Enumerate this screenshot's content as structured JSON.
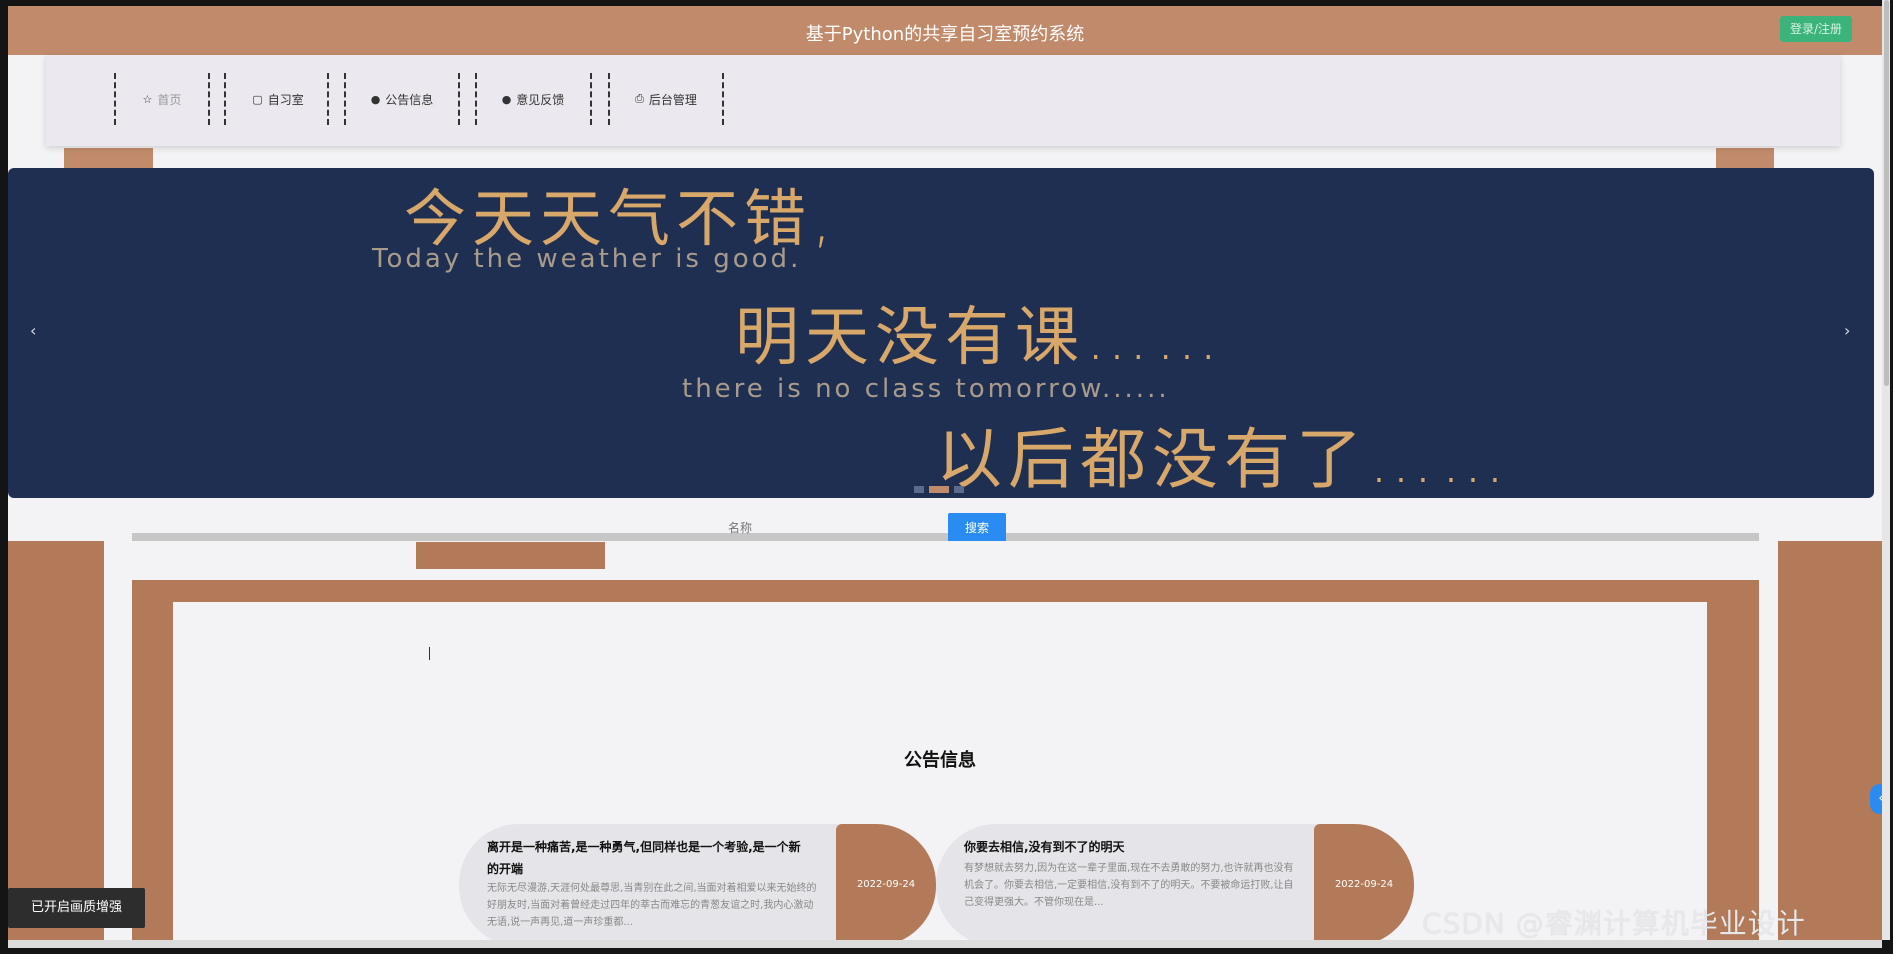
{
  "header": {
    "title": "基于Python的共享自习室预约系统",
    "login_label": "登录/注册",
    "colors": {
      "header_bg": "#c18b6b",
      "login_btn": "#3bb37a"
    }
  },
  "nav": {
    "items": [
      {
        "label": "首页",
        "icon": "star-icon"
      },
      {
        "label": "自习室",
        "icon": "bag-icon"
      },
      {
        "label": "公告信息",
        "icon": "info-circle-icon"
      },
      {
        "label": "意见反馈",
        "icon": "question-circle-icon"
      },
      {
        "label": "后台管理",
        "icon": "print-icon"
      }
    ]
  },
  "banner": {
    "lines": [
      "今天天气不错,",
      "Today the weather is good.",
      "明天没有课……",
      "there is no class tomorrow......",
      "以后都没有了……"
    ],
    "prev_icon": "chevron-left-icon",
    "next_icon": "chevron-right-icon",
    "slide_count": 3,
    "active_slide": 2
  },
  "search": {
    "placeholder": "名称",
    "button_label": "搜索",
    "button_color": "#2a8cf2"
  },
  "notices": {
    "section_title": "公告信息",
    "items": [
      {
        "title": "离开是一种痛苦,是一种勇气,但同样也是一个考验,是一个新的开端",
        "excerpt": "无际无尽漫游,天涯何处最尊思,当青别在此之间,当面对着相爱以来无始终的好朋友时,当面对着曾经走过四年的莘古而难忘的青葱友谊之时,我内心激动无语,说一声再见,道一声珍重都...",
        "date": "2022-09-24"
      },
      {
        "title": "你要去相信,没有到不了的明天",
        "excerpt": "有梦想就去努力,因为在这一辈子里面,现在不去勇敢的努力,也许就再也没有机会了。你要去相信,一定要相信,没有到不了的明天。不要被命运打败,让自己变得更强大。不管你现在是...",
        "date": "2022-09-24"
      }
    ]
  },
  "toast": "已开启画质增强",
  "watermark": "CSDN @睿渊计算机毕业设计"
}
